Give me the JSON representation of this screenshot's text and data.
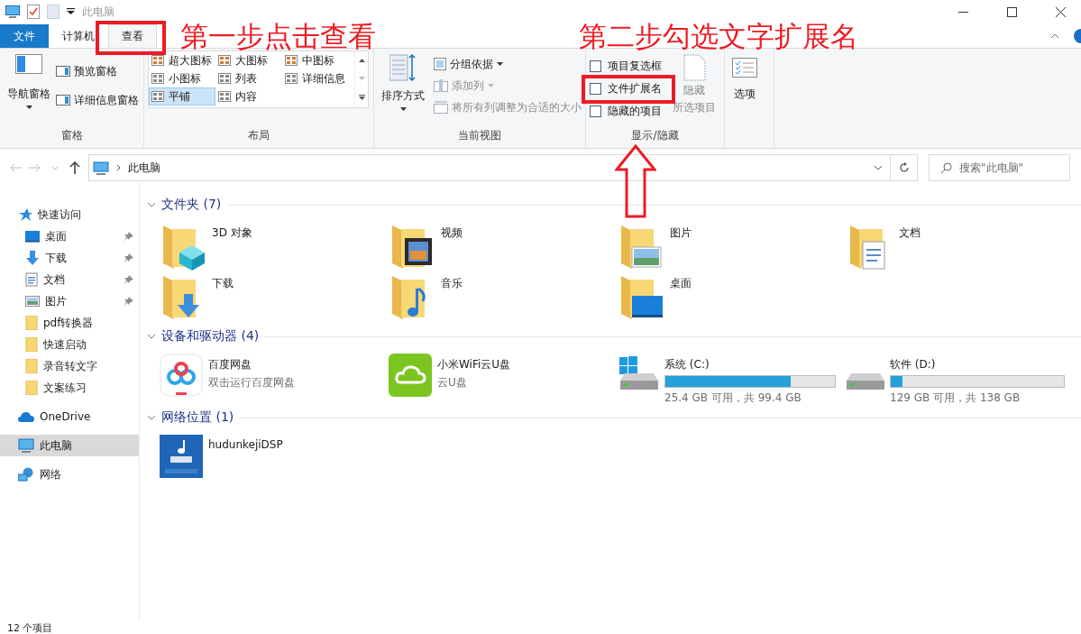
{
  "title_bar": {
    "title": "此电脑"
  },
  "ribbon_tabs": [
    {
      "label": "文件",
      "kind": "file",
      "selected": false
    },
    {
      "label": "计算机",
      "kind": "tab",
      "selected": false
    },
    {
      "label": "查看",
      "kind": "tab",
      "selected": true
    }
  ],
  "ribbon": {
    "panes": {
      "label": "窗格",
      "nav_pane": "导航窗格",
      "preview_pane": "预览窗格",
      "details_pane": "详细信息窗格"
    },
    "layout": {
      "label": "布局",
      "options": [
        {
          "label": "超大图标",
          "selected": false
        },
        {
          "label": "大图标",
          "selected": false
        },
        {
          "label": "中图标",
          "selected": false
        },
        {
          "label": "小图标",
          "selected": false
        },
        {
          "label": "列表",
          "selected": false
        },
        {
          "label": "详细信息",
          "selected": false
        },
        {
          "label": "平铺",
          "selected": true
        },
        {
          "label": "内容",
          "selected": false
        }
      ]
    },
    "current_view": {
      "label": "当前视图",
      "sort_by": "排序方式",
      "group_by": {
        "label": "分组依据",
        "disabled": false
      },
      "add_column": {
        "label": "添加列",
        "disabled": true
      },
      "fit_columns": {
        "label": "将所有列调整为合适的大小",
        "disabled": true
      }
    },
    "show_hide": {
      "label": "显示/隐藏",
      "checkboxes": [
        {
          "label": "项目复选框",
          "checked": false
        },
        {
          "label": "文件扩展名",
          "checked": false
        },
        {
          "label": "隐藏的项目",
          "checked": false
        }
      ],
      "hide_selected": {
        "label": "隐藏",
        "sublabel": "所选项目",
        "disabled": true
      }
    },
    "options": {
      "label": "选项"
    }
  },
  "address_bar": {
    "path": "此电脑",
    "search_placeholder": "搜索\"此电脑\""
  },
  "sidebar": [
    {
      "label": "快速访问",
      "kind": "star",
      "selected": false,
      "children": [
        {
          "label": "桌面",
          "kind": "desktop",
          "pinned": true,
          "selected": false
        },
        {
          "label": "下载",
          "kind": "download",
          "pinned": true,
          "selected": false
        },
        {
          "label": "文档",
          "kind": "document",
          "pinned": true,
          "selected": false
        },
        {
          "label": "图片",
          "kind": "picture",
          "pinned": true,
          "selected": false
        },
        {
          "label": "pdf转换器",
          "kind": "folder",
          "pinned": false,
          "selected": false
        },
        {
          "label": "快速启动",
          "kind": "folder",
          "pinned": false,
          "selected": false
        },
        {
          "label": "录音转文字",
          "kind": "folder",
          "pinned": false,
          "selected": false
        },
        {
          "label": "文案练习",
          "kind": "folder",
          "pinned": false,
          "selected": false
        }
      ]
    },
    {
      "label": "OneDrive",
      "kind": "cloud",
      "selected": false
    },
    {
      "label": "此电脑",
      "kind": "pc",
      "selected": true
    },
    {
      "label": "网络",
      "kind": "network",
      "selected": false
    }
  ],
  "sections": [
    {
      "title": "文件夹 (7)",
      "expanded": true,
      "items": [
        {
          "name": "3D 对象",
          "kind": "folder-cube"
        },
        {
          "name": "视频",
          "kind": "folder-video"
        },
        {
          "name": "图片",
          "kind": "folder-picture"
        },
        {
          "name": "文档",
          "kind": "folder-document"
        },
        {
          "name": "下载",
          "kind": "folder-download"
        },
        {
          "name": "音乐",
          "kind": "folder-music"
        },
        {
          "name": "桌面",
          "kind": "folder-desktop"
        }
      ]
    },
    {
      "title": "设备和驱动器 (4)",
      "expanded": true,
      "items": [
        {
          "name": "百度网盘",
          "detail": "双击运行百度网盘",
          "kind": "app-baidu"
        },
        {
          "name": "小米WiFi云U盘",
          "detail": "云U盘",
          "kind": "app-cloud"
        },
        {
          "name": "系统 (C:)",
          "detail": "25.4 GB 可用，共 99.4 GB",
          "kind": "drive-system",
          "level": 0.74
        },
        {
          "name": "软件 (D:)",
          "detail": "129 GB 可用，共 138 GB",
          "kind": "drive",
          "level": 0.07
        }
      ]
    },
    {
      "title": "网络位置 (1)",
      "expanded": true,
      "items": [
        {
          "name": "hudunkejiDSP",
          "kind": "nas"
        }
      ]
    }
  ],
  "status_bar": {
    "count": "12 个项目"
  },
  "annotations": [
    {
      "text": "第一步点击查看"
    },
    {
      "text": "第二步勾选文字扩展名"
    }
  ]
}
